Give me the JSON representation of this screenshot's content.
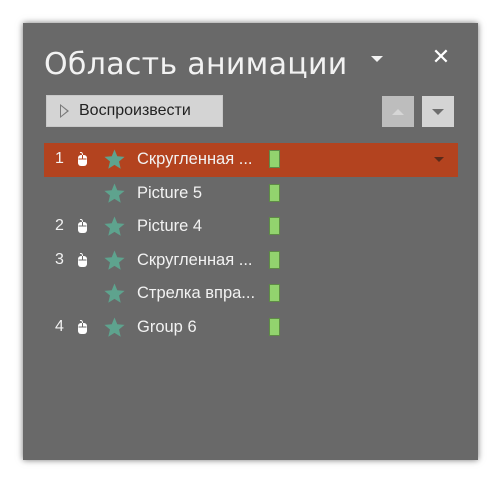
{
  "pane": {
    "title": "Область анимации",
    "play_label": "Воспроизвести"
  },
  "icons": {
    "menu": "chevron-down-icon",
    "close": "close-icon",
    "play": "play-icon",
    "move_up": "triangle-up-icon",
    "move_down": "triangle-down-icon",
    "trigger": "mouse-icon",
    "effect": "star-icon"
  },
  "colors": {
    "pane_bg": "#696969",
    "selected_row": "#b3431f",
    "star": "#5ea38e",
    "timeline_bar": "#92d36e"
  },
  "animations": [
    {
      "number": "1",
      "has_mouse": true,
      "label": "Скругленная ...",
      "selected": true
    },
    {
      "number": "",
      "has_mouse": false,
      "label": "Picture 5",
      "selected": false
    },
    {
      "number": "2",
      "has_mouse": true,
      "label": "Picture 4",
      "selected": false
    },
    {
      "number": "3",
      "has_mouse": true,
      "label": "Скругленная ...",
      "selected": false
    },
    {
      "number": "",
      "has_mouse": false,
      "label": "Стрелка впра...",
      "selected": false
    },
    {
      "number": "4",
      "has_mouse": true,
      "label": "Group 6",
      "selected": false
    }
  ]
}
